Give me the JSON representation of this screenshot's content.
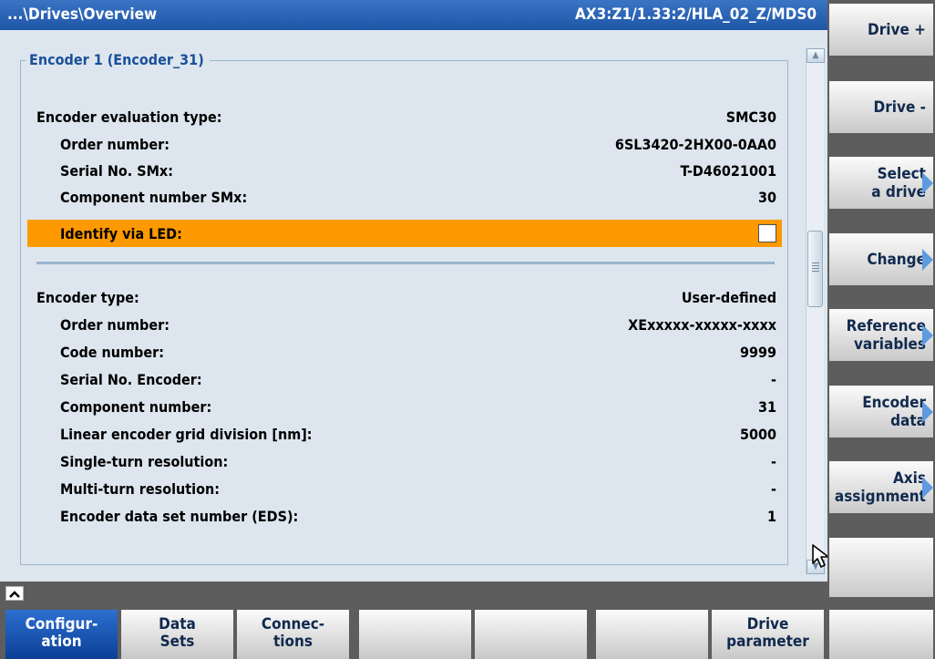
{
  "header": {
    "path": "...\\Drives\\Overview",
    "drive_id": "AX3:Z1/1.33:2/HLA_02_Z/MDS0"
  },
  "group": {
    "title": "Encoder 1 (Encoder_31)"
  },
  "encoder_module": {
    "eval_type_label": "Encoder evaluation type:",
    "eval_type_value": "SMC30",
    "order_label": "Order number:",
    "order_value": "6SL3420-2HX00-0AA0",
    "serial_label": "Serial No. SMx:",
    "serial_value": "T-D46021001",
    "component_label": "Component number SMx:",
    "component_value": "30",
    "identify_label": "Identify via LED:",
    "identify_checked": false
  },
  "encoder": {
    "type_label": "Encoder type:",
    "type_value": "User-defined",
    "order_label": "Order number:",
    "order_value": "XExxxxx-xxxxx-xxxx",
    "code_label": "Code number:",
    "code_value": "9999",
    "serial_label": "Serial No. Encoder:",
    "serial_value": "-",
    "component_label": "Component number:",
    "component_value": "31",
    "grid_label": "Linear encoder grid division [nm]:",
    "grid_value": "5000",
    "single_turn_label": "Single-turn resolution:",
    "single_turn_value": "-",
    "multi_turn_label": "Multi-turn resolution:",
    "multi_turn_value": "-",
    "eds_label": "Encoder data set number (EDS):",
    "eds_value": "1"
  },
  "vertical_softkeys": {
    "drive_plus": "Drive +",
    "drive_minus": "Drive -",
    "select_drive": "Select\na drive",
    "change": "Change",
    "reference_variables": "Reference\nvariables",
    "encoder_data": "Encoder\ndata",
    "axis_assignment": "Axis\nassignment"
  },
  "horizontal_softkeys": {
    "configuration": "Configur-\nation",
    "data_sets": "Data\nSets",
    "connections": "Connec-\ntions",
    "drive_parameter": "Drive\nparameter"
  },
  "colors": {
    "title_bar": "#2b64b8",
    "panel_bg": "#dde6ee",
    "highlight": "#ff9900",
    "active_key": "#1b56b3"
  },
  "icons": [
    "recall-icon",
    "scroll-up-icon",
    "scroll-down-icon",
    "mouse-cursor-icon",
    "softkey-arrow-icon"
  ]
}
